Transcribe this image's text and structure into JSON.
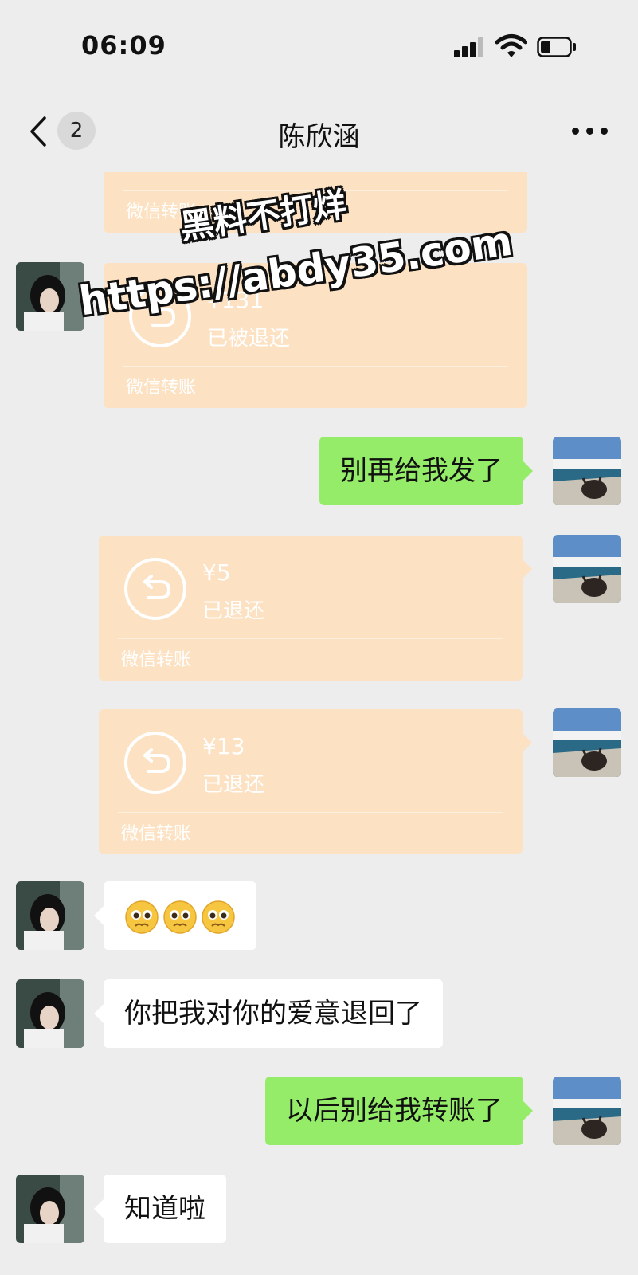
{
  "status_bar": {
    "time": "06:09"
  },
  "nav": {
    "unread_count": "2",
    "title": "陈欣涵"
  },
  "transfers": {
    "top_partial": {
      "footer": "微信转账"
    },
    "refunded_131": {
      "amount": "¥131",
      "status": "已被退还",
      "footer": "微信转账"
    },
    "refunded_5": {
      "amount": "¥5",
      "status": "已退还",
      "footer": "微信转账"
    },
    "refunded_13": {
      "amount": "¥13",
      "status": "已退还",
      "footer": "微信转账"
    }
  },
  "messages": {
    "msg_stop_sending": "别再给我发了",
    "msg_returned_love": "你把我对你的爱意退回了",
    "msg_no_more_transfers": "以后别给我转账了",
    "msg_got_it": "知道啦"
  },
  "emoji_message": {
    "icons": [
      "pleading-face-icon",
      "pleading-face-icon",
      "pleading-face-icon"
    ]
  },
  "watermark": {
    "line1": "黑料不打烊",
    "line2": "https://abdy35.com"
  },
  "colors": {
    "self_bubble": "#95ec69",
    "other_bubble": "#ffffff",
    "refunded_transfer": "#fce2c3",
    "background": "#ededed"
  }
}
